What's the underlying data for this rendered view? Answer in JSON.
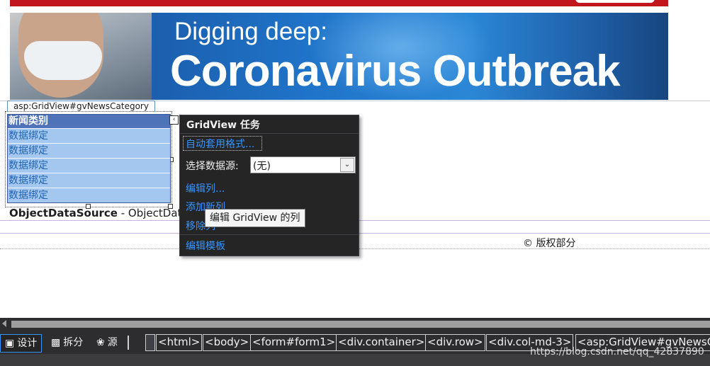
{
  "banner": {
    "line1": "Digging deep:",
    "line2": "Coronavirus Outbreak"
  },
  "gridview": {
    "tag": "asp:GridView#gvNewsCategory",
    "header": "新闻类别",
    "rows": [
      "数据绑定",
      "数据绑定",
      "数据绑定",
      "数据绑定",
      "数据绑定"
    ]
  },
  "objectdatasource": {
    "bold": "ObjectDataSource",
    "rest": " - ObjectDataS"
  },
  "footer": {
    "copyright": "© 版权部分"
  },
  "tasks_panel": {
    "title": "GridView 任务",
    "auto_format": "自动套用格式...",
    "datasource_label": "选择数据源:",
    "datasource_value": "(无)",
    "edit_columns": "编辑列...",
    "add_column": "添加新列",
    "remove_column": "移除列",
    "edit_templates": "编辑模板"
  },
  "tooltip": {
    "text": "编辑 GridView 的列"
  },
  "view_tabs": {
    "design": "设计",
    "split": "拆分",
    "source": "源"
  },
  "breadcrumb": [
    "<html>",
    "<body>",
    "<form#form1>",
    "<div.container>",
    "<div.row>",
    "<div.col-md-3>",
    "<asp:GridView#gvNewsC"
  ],
  "watermark": "https://blog.csdn.net/qq_42837890",
  "colors": {
    "banner_red": "#c2161e",
    "grid_header": "#4f73b8",
    "grid_row": "#a3c7ee",
    "panel_bg": "#252526",
    "link": "#3794ff"
  }
}
